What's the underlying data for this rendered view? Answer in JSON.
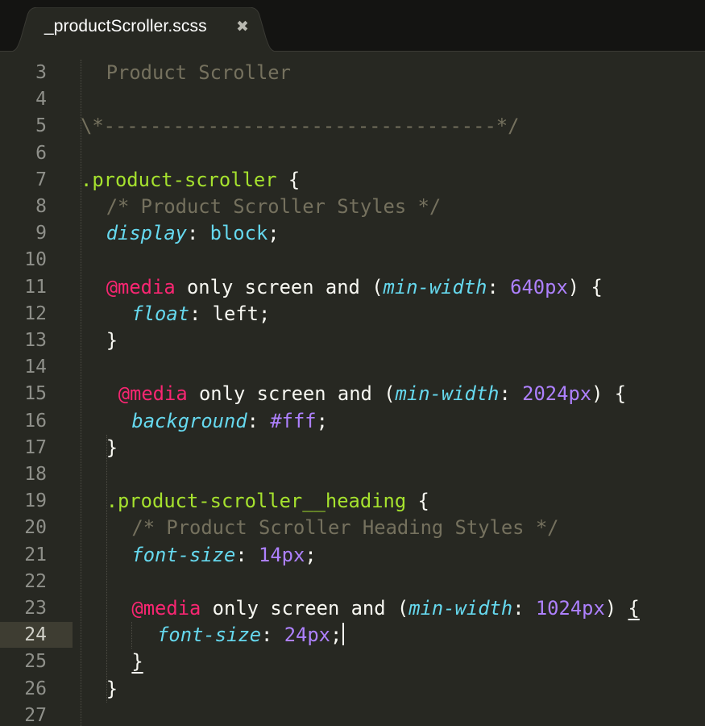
{
  "tab": {
    "title": "_productScroller.scss",
    "close_glyph": "✖"
  },
  "editor": {
    "current_line": 24,
    "lines": [
      {
        "n": "3",
        "indent": 1,
        "tokens": [
          {
            "t": "Product Scroller",
            "c": "comment"
          }
        ]
      },
      {
        "n": "4",
        "indent": 0,
        "tokens": []
      },
      {
        "n": "5",
        "indent": 0,
        "tokens": [
          {
            "t": "\\*----------------------------------*/",
            "c": "comment"
          }
        ]
      },
      {
        "n": "6",
        "indent": 0,
        "tokens": []
      },
      {
        "n": "7",
        "indent": 0,
        "tokens": [
          {
            "t": ".product-scroller",
            "c": "selector"
          },
          {
            "t": " {",
            "c": "plain"
          }
        ]
      },
      {
        "n": "8",
        "indent": 1,
        "tokens": [
          {
            "t": "/* Product Scroller Styles */",
            "c": "comment"
          }
        ]
      },
      {
        "n": "9",
        "indent": 1,
        "tokens": [
          {
            "t": "display",
            "c": "prop"
          },
          {
            "t": ": ",
            "c": "plain"
          },
          {
            "t": "block",
            "c": "val"
          },
          {
            "t": ";",
            "c": "plain"
          }
        ]
      },
      {
        "n": "10",
        "indent": 0,
        "tokens": []
      },
      {
        "n": "11",
        "indent": 1,
        "tokens": [
          {
            "t": "@media",
            "c": "kw"
          },
          {
            "t": " only screen and (",
            "c": "plain"
          },
          {
            "t": "min-width",
            "c": "prop"
          },
          {
            "t": ": ",
            "c": "plain"
          },
          {
            "t": "640px",
            "c": "num"
          },
          {
            "t": ") {",
            "c": "plain"
          }
        ]
      },
      {
        "n": "12",
        "indent": 2,
        "tokens": [
          {
            "t": "float",
            "c": "prop"
          },
          {
            "t": ": left;",
            "c": "plain"
          }
        ]
      },
      {
        "n": "13",
        "indent": 1,
        "tokens": [
          {
            "t": "}",
            "c": "plain"
          }
        ]
      },
      {
        "n": "14",
        "indent": 0,
        "tokens": []
      },
      {
        "n": "15",
        "indent": 1,
        "offset": 15,
        "tokens": [
          {
            "t": "@media",
            "c": "kw"
          },
          {
            "t": " only screen and (",
            "c": "plain"
          },
          {
            "t": "min-width",
            "c": "prop"
          },
          {
            "t": ": ",
            "c": "plain"
          },
          {
            "t": "2024px",
            "c": "num"
          },
          {
            "t": ") {",
            "c": "plain"
          }
        ]
      },
      {
        "n": "16",
        "indent": 2,
        "tokens": [
          {
            "t": "background",
            "c": "prop"
          },
          {
            "t": ": ",
            "c": "plain"
          },
          {
            "t": "#fff",
            "c": "num"
          },
          {
            "t": ";",
            "c": "plain"
          }
        ]
      },
      {
        "n": "17",
        "indent": 1,
        "tokens": [
          {
            "t": "}",
            "c": "plain"
          }
        ]
      },
      {
        "n": "18",
        "indent": 0,
        "tokens": []
      },
      {
        "n": "19",
        "indent": 1,
        "tokens": [
          {
            "t": ".product-scroller__heading",
            "c": "selector"
          },
          {
            "t": " {",
            "c": "plain"
          }
        ]
      },
      {
        "n": "20",
        "indent": 2,
        "tokens": [
          {
            "t": "/* Product Scroller Heading Styles */",
            "c": "comment"
          }
        ]
      },
      {
        "n": "21",
        "indent": 2,
        "tokens": [
          {
            "t": "font-size",
            "c": "prop"
          },
          {
            "t": ": ",
            "c": "plain"
          },
          {
            "t": "14px",
            "c": "num"
          },
          {
            "t": ";",
            "c": "plain"
          }
        ]
      },
      {
        "n": "22",
        "indent": 0,
        "tokens": []
      },
      {
        "n": "23",
        "indent": 2,
        "tokens": [
          {
            "t": "@media",
            "c": "kw"
          },
          {
            "t": " only screen and (",
            "c": "plain"
          },
          {
            "t": "min-width",
            "c": "prop"
          },
          {
            "t": ": ",
            "c": "plain"
          },
          {
            "t": "1024px",
            "c": "num"
          },
          {
            "t": ") ",
            "c": "plain"
          },
          {
            "t": "{",
            "c": "bracket-match"
          }
        ]
      },
      {
        "n": "24",
        "indent": 3,
        "cursor": true,
        "tokens": [
          {
            "t": "font-size",
            "c": "prop"
          },
          {
            "t": ": ",
            "c": "plain"
          },
          {
            "t": "24px",
            "c": "num"
          },
          {
            "t": ";",
            "c": "plain"
          }
        ]
      },
      {
        "n": "25",
        "indent": 2,
        "tokens": [
          {
            "t": "}",
            "c": "bracket-match"
          }
        ]
      },
      {
        "n": "26",
        "indent": 1,
        "tokens": [
          {
            "t": "}",
            "c": "plain"
          }
        ]
      },
      {
        "n": "27",
        "indent": 0,
        "tokens": []
      }
    ]
  }
}
